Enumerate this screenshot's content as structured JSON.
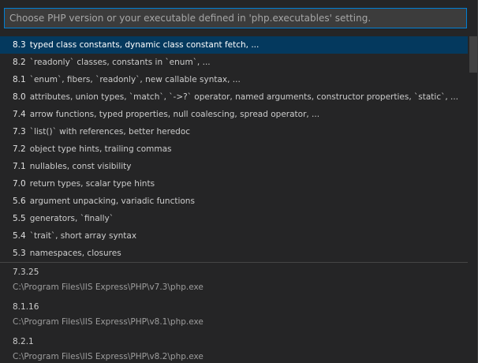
{
  "search": {
    "placeholder": "Choose PHP version or your executable defined in 'php.executables' setting.",
    "value": ""
  },
  "versions": [
    {
      "version": "8.3",
      "description": "typed class constants, dynamic class constant fetch, ..."
    },
    {
      "version": "8.2",
      "description": "`readonly` classes, constants in `enum`, ..."
    },
    {
      "version": "8.1",
      "description": "`enum`, fibers, `readonly`, new callable syntax, ..."
    },
    {
      "version": "8.0",
      "description": "attributes, union types, `match`, `->?` operator, named arguments, constructor properties, `static`, ..."
    },
    {
      "version": "7.4",
      "description": "arrow functions, typed properties, null coalescing, spread operator, ..."
    },
    {
      "version": "7.3",
      "description": "`list()` with references, better heredoc"
    },
    {
      "version": "7.2",
      "description": "object type hints, trailing commas"
    },
    {
      "version": "7.1",
      "description": "nullables, const visibility"
    },
    {
      "version": "7.0",
      "description": "return types, scalar type hints"
    },
    {
      "version": "5.6",
      "description": "argument unpacking, variadic functions"
    },
    {
      "version": "5.5",
      "description": "generators, `finally`"
    },
    {
      "version": "5.4",
      "description": "`trait`, short array syntax"
    },
    {
      "version": "5.3",
      "description": "namespaces, closures"
    }
  ],
  "executables": [
    {
      "name": "7.3.25",
      "path": "C:\\Program Files\\IIS Express\\PHP\\v7.3\\php.exe"
    },
    {
      "name": "8.1.16",
      "path": "C:\\Program Files\\IIS Express\\PHP\\v8.1\\php.exe"
    },
    {
      "name": "8.2.1",
      "path": "C:\\Program Files\\IIS Express\\PHP\\v8.2\\php.exe"
    }
  ],
  "colors": {
    "accent": "#007fd4",
    "selected_bg": "#04395e",
    "background": "#252526"
  }
}
